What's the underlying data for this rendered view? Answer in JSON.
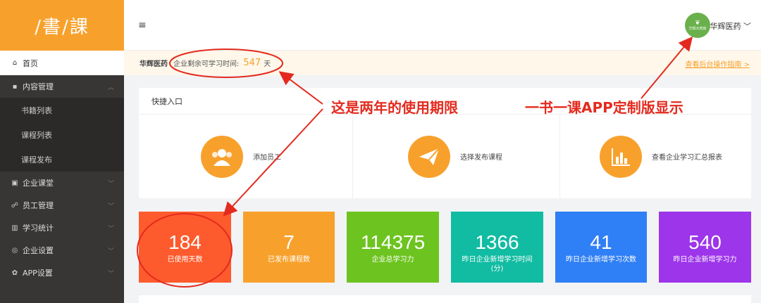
{
  "brand": {
    "logo_text": "/書/課"
  },
  "sidebar": {
    "home": {
      "label": "首页"
    },
    "content": {
      "label": "内容管理",
      "items": [
        {
          "label": "书籍列表"
        },
        {
          "label": "课程列表"
        },
        {
          "label": "课程发布"
        }
      ]
    },
    "groups": [
      {
        "label": "企业课堂"
      },
      {
        "label": "员工管理"
      },
      {
        "label": "学习统计"
      },
      {
        "label": "企业设置"
      },
      {
        "label": "APP设置"
      }
    ]
  },
  "header": {
    "menu_icon": "≡",
    "avatar_text": "华辉大药房",
    "company": "华辉医药"
  },
  "notice": {
    "company": "华辉医药",
    "label": "企业剩余可学习时间:",
    "days": "547",
    "unit": "天",
    "link": "查看后台操作指南 >"
  },
  "quick": {
    "title": "快捷入口",
    "items": [
      {
        "label": "添加员工",
        "icon": "users-icon"
      },
      {
        "label": "选择发布课程",
        "icon": "paper-plane-icon"
      },
      {
        "label": "查看企业学习汇总报表",
        "icon": "bar-chart-icon"
      }
    ]
  },
  "stats": [
    {
      "value": "184",
      "label": "已使用天数",
      "color": "#fd5b2d"
    },
    {
      "value": "7",
      "label": "已发布课程数",
      "color": "#f7a12c"
    },
    {
      "value": "114375",
      "label": "企业总学习力",
      "color": "#6dc420"
    },
    {
      "value": "1366",
      "label": "昨日企业新增学习时间(分)",
      "color": "#11bca2"
    },
    {
      "value": "41",
      "label": "昨日企业新增学习次数",
      "color": "#2f7ff6"
    },
    {
      "value": "540",
      "label": "昨日企业新增学习力",
      "color": "#9d35ea"
    }
  ],
  "annotations": {
    "term": "这是两年的使用期限",
    "app": "一书一课APP定制版显示"
  },
  "colors": {
    "accent": "#f7a12c",
    "annotation": "#e42a1e"
  }
}
